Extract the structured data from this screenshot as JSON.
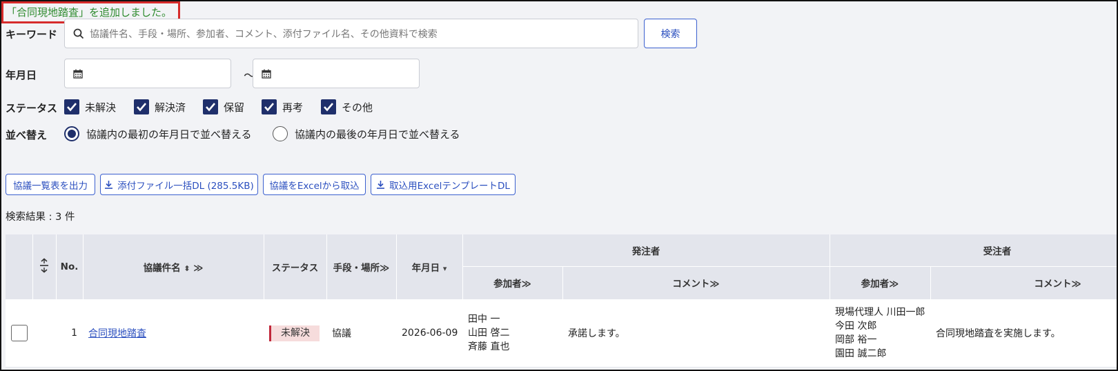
{
  "notice": "「合同現地踏査」を追加しました。",
  "filters": {
    "keyword_label": "キーワード",
    "keyword_placeholder": "協議件名、手段・場所、参加者、コメント、添付ファイル名、その他資料で検索",
    "search_button": "検索",
    "date_label": "年月日",
    "date_separator": "～",
    "status_label": "ステータス",
    "statuses": [
      {
        "label": "未解決",
        "checked": true
      },
      {
        "label": "解決済",
        "checked": true
      },
      {
        "label": "保留",
        "checked": true
      },
      {
        "label": "再考",
        "checked": true
      },
      {
        "label": "その他",
        "checked": true
      }
    ],
    "sort_label": "並べ替え",
    "sort_options": [
      {
        "label": "協議内の最初の年月日で並べ替える",
        "selected": true
      },
      {
        "label": "協議内の最後の年月日で並べ替える",
        "selected": false
      }
    ]
  },
  "actions": {
    "export_list": "協議一覧表を出力",
    "bulk_download": "添付ファイル一括DL (285.5KB)",
    "import_excel": "協議をExcelから取込",
    "template_download": "取込用ExcelテンプレートDL"
  },
  "result_count": "検索結果 : 3 件",
  "table": {
    "headers": {
      "no": "No.",
      "title": "協議件名",
      "status": "ステータス",
      "method": "手段・場所",
      "date": "年月日",
      "orderer": "発注者",
      "contractor": "受注者",
      "participants": "参加者",
      "comment": "コメント"
    },
    "rows": [
      {
        "no": "1",
        "title": "合同現地踏査",
        "status": "未解決",
        "method": "協議",
        "date": "2026-06-09",
        "orderer_participants": [
          "田中 一",
          "山田 啓二",
          "斉藤 直也"
        ],
        "orderer_comment": "承諾します。",
        "contractor_participants": [
          "現場代理人 川田一郎",
          "今田 次郎",
          "岡部 裕一",
          "園田 誠二郎"
        ],
        "contractor_comment": "合同現地踏査を実施します。"
      }
    ]
  },
  "colors": {
    "accent": "#2b4fbf",
    "checkbox": "#1f2f6b",
    "notice_border": "#d62b2b",
    "notice_text": "#2e8b2e",
    "status_unresolved": "#c0273a"
  }
}
